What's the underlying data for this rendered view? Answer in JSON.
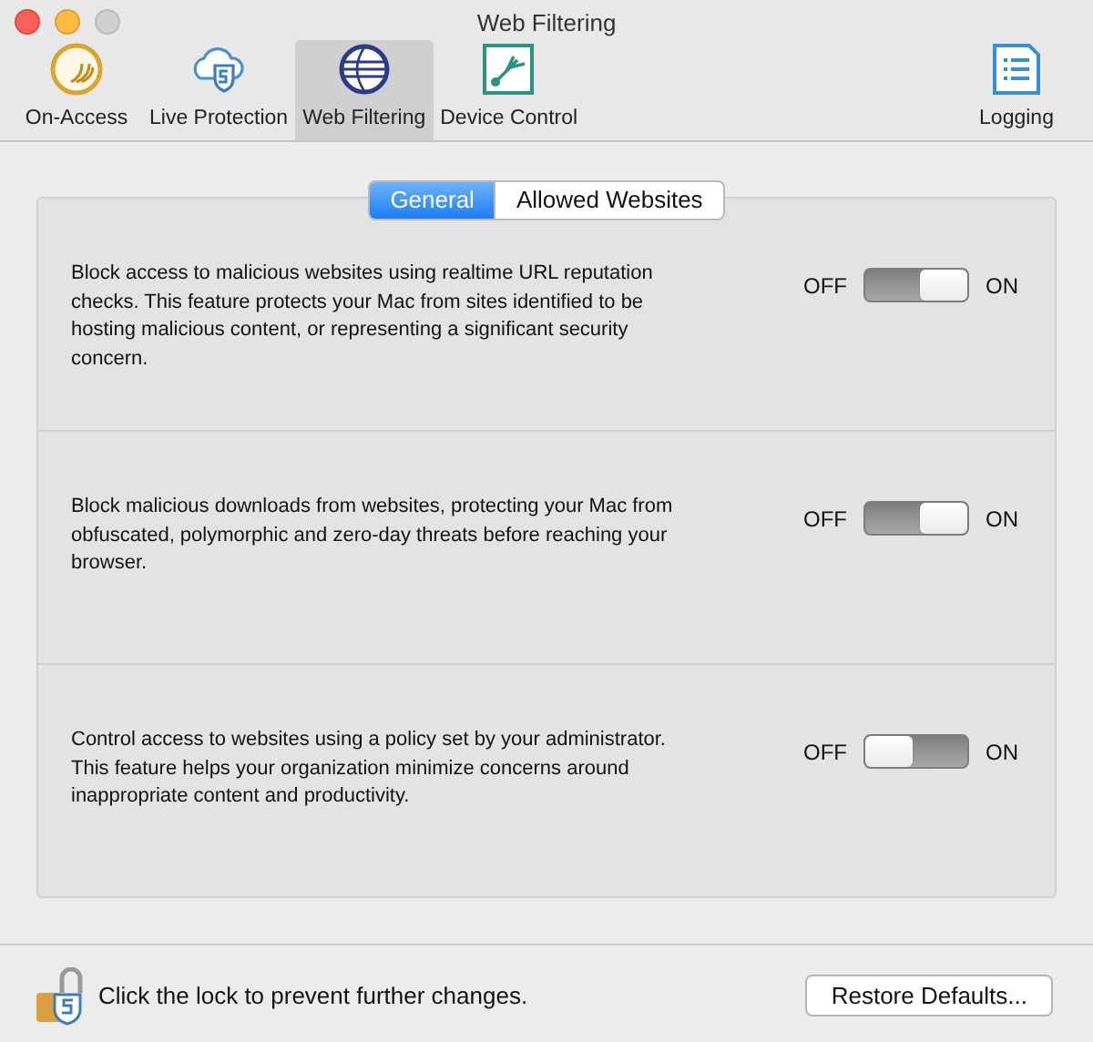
{
  "window": {
    "title": "Web Filtering"
  },
  "toolbar": {
    "items": [
      {
        "label": "On-Access",
        "selected": false
      },
      {
        "label": "Live Protection",
        "selected": false
      },
      {
        "label": "Web Filtering",
        "selected": true
      },
      {
        "label": "Device Control",
        "selected": false
      }
    ],
    "trailing_items": [
      {
        "label": "Logging",
        "selected": false
      }
    ]
  },
  "segments": [
    {
      "label": "General",
      "selected": true
    },
    {
      "label": "Allowed Websites",
      "selected": false
    }
  ],
  "settings": [
    {
      "description": "Block access to malicious websites using realtime URL reputation checks. This feature protects your Mac from sites identified to be hosting malicious content, or representing a significant security concern.",
      "off_label": "OFF",
      "on_label": "ON",
      "on": true
    },
    {
      "description": "Block malicious downloads from websites, protecting your Mac from obfuscated, polymorphic and zero-day threats before reaching your browser.",
      "off_label": "OFF",
      "on_label": "ON",
      "on": true
    },
    {
      "description": "Control access to websites using a policy set by your administrator.  This feature helps your organization minimize concerns around inappropriate content and productivity.",
      "off_label": "OFF",
      "on_label": "ON",
      "on": false
    }
  ],
  "footer": {
    "lock_text": "Click the lock to prevent further changes.",
    "button": "Restore Defaults..."
  }
}
